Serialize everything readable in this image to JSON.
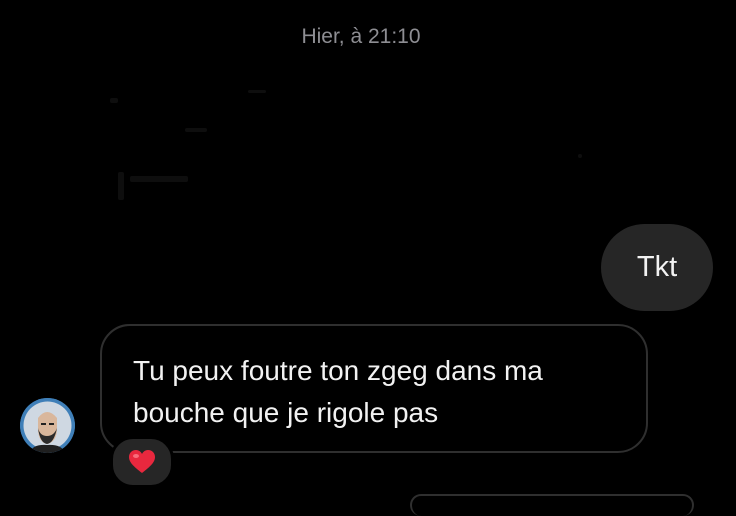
{
  "thread": {
    "timestamp": "Hier, à 21:10"
  },
  "messages": [
    {
      "direction": "outgoing",
      "text": "Tkt"
    },
    {
      "direction": "incoming",
      "text": "Tu peux foutre ton zgeg dans ma bouche que je rigole pas",
      "reaction": "heart"
    }
  ],
  "colors": {
    "background": "#000000",
    "outgoing_bubble": "#262626",
    "incoming_border": "#2f2f2f",
    "timestamp": "#8e8e93",
    "heart": "#e8283e",
    "avatar_bg": "#3f7fb8"
  },
  "icons": {
    "avatar": "user-avatar",
    "reaction": "heart-icon"
  }
}
